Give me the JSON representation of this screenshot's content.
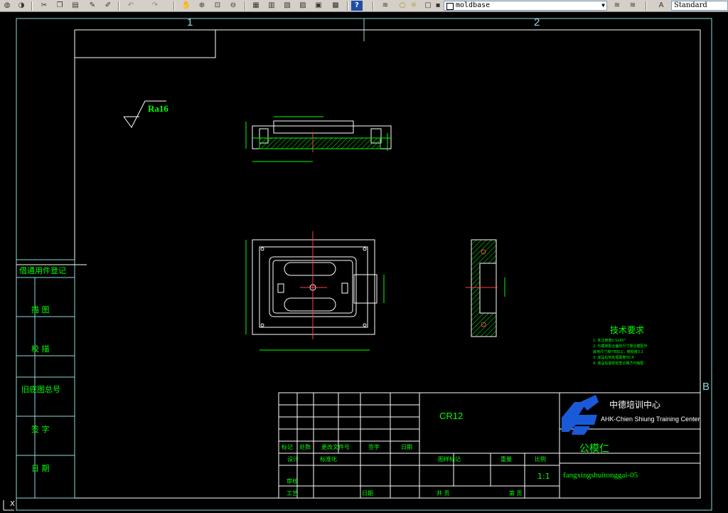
{
  "toolbar": {
    "buttons": [
      {
        "icon": "globe-icon"
      },
      {
        "icon": "cut-icon"
      },
      {
        "icon": "copy-icon"
      },
      {
        "icon": "paste-icon"
      },
      {
        "icon": "match-properties-icon"
      },
      {
        "icon": "brush-icon"
      },
      {
        "icon": "undo-icon"
      },
      {
        "icon": "redo-icon"
      },
      {
        "icon": "pan-icon"
      },
      {
        "icon": "zoom-realtime-icon"
      },
      {
        "icon": "zoom-window-icon"
      },
      {
        "icon": "zoom-previous-icon"
      },
      {
        "icon": "properties-icon"
      },
      {
        "icon": "design-center-icon"
      },
      {
        "icon": "tool-palettes-icon"
      },
      {
        "icon": "sheet-set-icon"
      },
      {
        "icon": "markup-icon"
      },
      {
        "icon": "calculator-icon"
      },
      {
        "icon": "help-icon"
      },
      {
        "icon": "layers-icon"
      }
    ],
    "layer_name": "moldbase",
    "text_style": "Standard"
  },
  "frame": {
    "zone_1": "1",
    "zone_2": "2",
    "zone_b": "B",
    "side_labels": [
      "借通用件登记",
      "描  图",
      "校  描",
      "旧底图总号",
      "签  字",
      "日  期"
    ]
  },
  "drawing": {
    "roughness": "Ra16",
    "tech_title": "技术要求",
    "tech_notes": [
      "1. 未注倒角0.5x45°",
      "2. 与模架配合面的尺寸按合模配作",
      "   其他尺寸按IT8加工，粗糙度3.2",
      "3. 成品后热处理硬度50.4",
      "4. 成品后需经检查合格方可装配"
    ]
  },
  "title_block": {
    "material": "CR12",
    "company_cn": "中德培训中心",
    "company_en": "AHK-Chien Shiung Training Center",
    "part_name": "公模仁",
    "scale": "1:1",
    "drawing_no": "fangxingshuitonggai-05",
    "rev_headers": [
      "标记",
      "处数",
      "更改文件号",
      "签字",
      "日期"
    ],
    "role_labels": [
      "设计",
      "标准化",
      "审核",
      "工艺",
      "日期"
    ],
    "stage_label": "图样标记",
    "weight_label": "重量",
    "scale_label": "比例",
    "sheet_label": "共  页",
    "sheet_of_label": "第  页"
  }
}
